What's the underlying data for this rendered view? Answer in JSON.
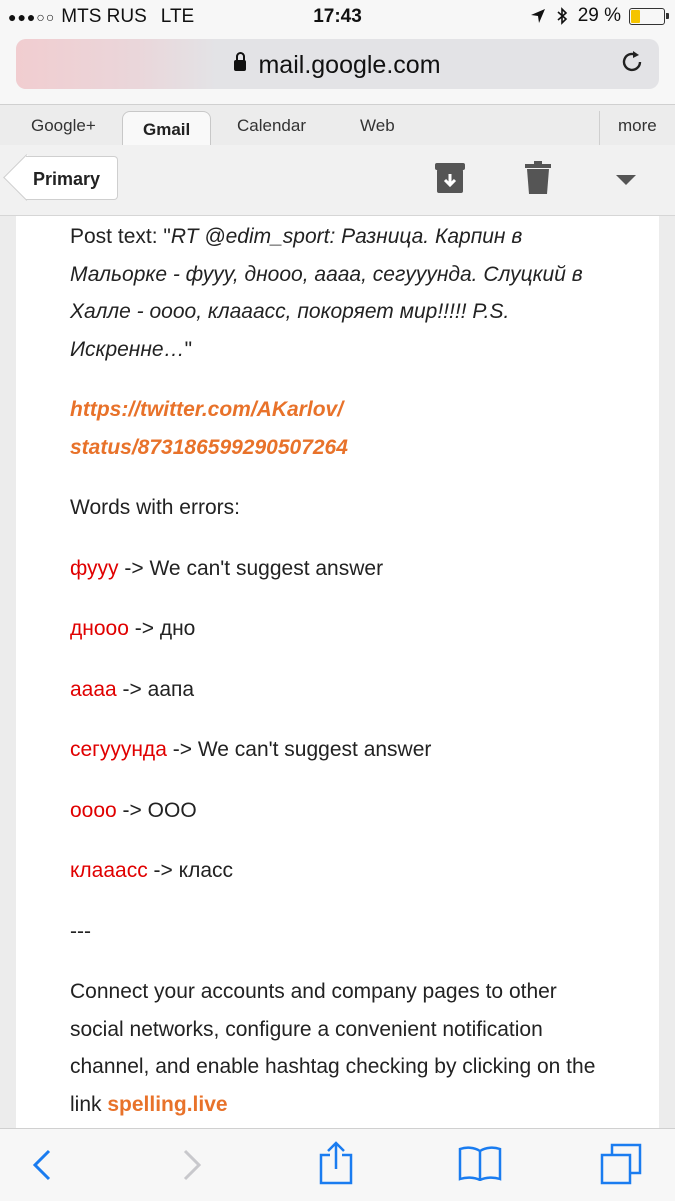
{
  "status": {
    "carrier": "MTS RUS",
    "network": "LTE",
    "time": "17:43",
    "battery_text": "29 %",
    "battery_level_percent": 29
  },
  "address_bar": {
    "url": "mail.google.com"
  },
  "tabs": [
    {
      "label": "Google+"
    },
    {
      "label": "Gmail"
    },
    {
      "label": "Calendar"
    },
    {
      "label": "Web"
    },
    {
      "label": "more"
    }
  ],
  "toolbar": {
    "back_label": "Primary",
    "icons": [
      "archive-icon",
      "trash-icon",
      "dropdown-arrow-icon"
    ]
  },
  "email": {
    "post_prefix": "Post text: \"",
    "post_text": "RT @edim_sport: Разница. Карпин в Мальорке - фууу, дноoo, аааа, сегууунда. Слуцкий в Халле - оооо, клааасс, покоряет мир!!!!! P.S. Искренне…",
    "post_suffix": "\"",
    "link_line1": "https://twitter.com/AKarlov/",
    "link_line2": "status/873186599290507264",
    "errors_heading": "Words with errors:",
    "errors": [
      {
        "word": "фууу",
        "arrow": " -> ",
        "suggestion": "We can't suggest answer"
      },
      {
        "word": "дноoo",
        "arrow": " -> ",
        "suggestion": "дно"
      },
      {
        "word": "аааа",
        "arrow": " -> ",
        "suggestion": "аапа"
      },
      {
        "word": "сегууунда",
        "arrow": " -> ",
        "suggestion": "We can't suggest answer"
      },
      {
        "word": "оооо",
        "arrow": " -> ",
        "suggestion": "ООО"
      },
      {
        "word": "клааасс",
        "arrow": " -> ",
        "suggestion": "класс"
      }
    ],
    "separator": "---",
    "footer_text": "Connect your accounts and company pages to other social networks, configure a convenient notification channel, and enable hashtag checking by clicking on the link ",
    "footer_link": "spelling.live"
  },
  "bottom_bar": {
    "icons": [
      "back-icon",
      "forward-icon",
      "share-icon",
      "bookmarks-icon",
      "tabs-icon"
    ]
  }
}
